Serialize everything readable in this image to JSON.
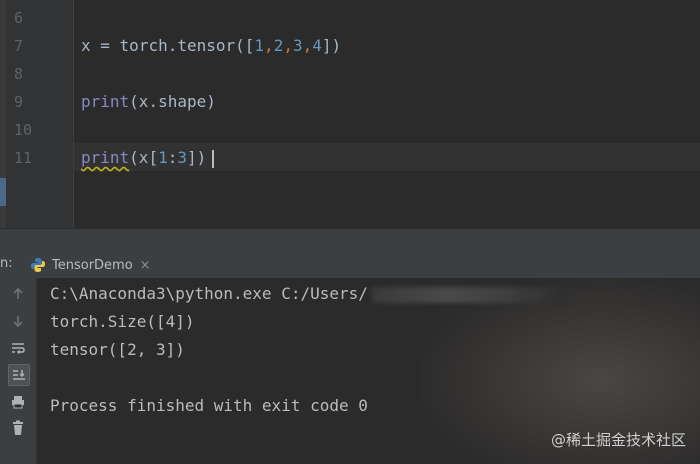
{
  "editor": {
    "line_numbers": [
      "6",
      "7",
      "8",
      "9",
      "10",
      "11"
    ],
    "line7": {
      "var": "x",
      "op": " = ",
      "call": "torch.tensor([",
      "n1": "1",
      "n2": "2",
      "n3": "3",
      "n4": "4",
      "close": "])"
    },
    "line9": {
      "fn": "print",
      "args": "(x.shape)"
    },
    "line11": {
      "fn": "print",
      "args_open": "(x[",
      "n1": "1",
      "colon": ":",
      "n2": "3",
      "args_close": "])"
    },
    "comma": ","
  },
  "run_panel": {
    "label": "n:",
    "tab_label": "TensorDemo",
    "tab_close": "×"
  },
  "console": {
    "command_prefix": "C:\\Anaconda3\\python.exe C:/Users/",
    "line_size": "torch.Size([4])",
    "line_tensor": "tensor([2, 3])",
    "line_exit": "Process finished with exit code 0"
  },
  "watermark": "@稀土掘金技术社区",
  "colors": {
    "editor_bg": "#2b2b2b",
    "keyword_builtin": "#8888c6",
    "number": "#6897bb",
    "comma": "#cc7832",
    "text": "#a9b7c6"
  }
}
